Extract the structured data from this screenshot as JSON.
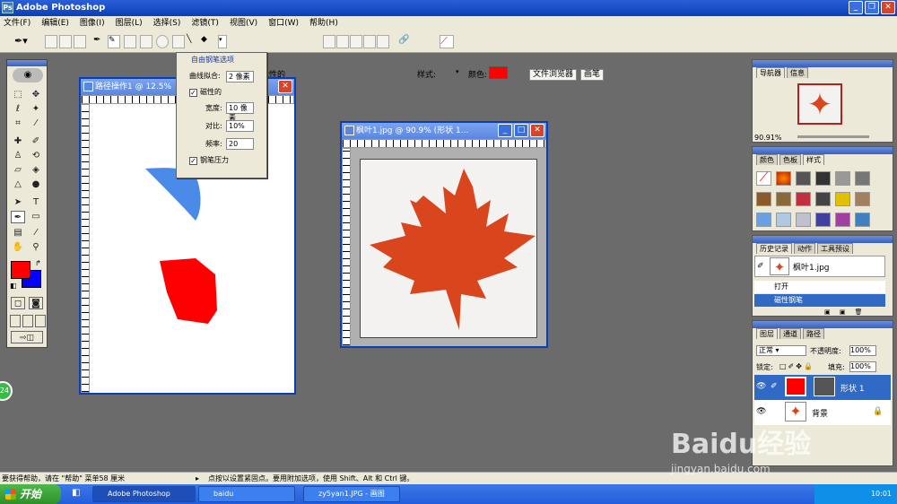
{
  "window": {
    "title": "Adobe Photoshop"
  },
  "menu": [
    "文件(F)",
    "编辑(E)",
    "图像(I)",
    "图层(L)",
    "选择(S)",
    "滤镜(T)",
    "视图(V)",
    "窗口(W)",
    "帮助(H)"
  ],
  "options": {
    "magnetic_label": "磁性的",
    "style_label": "样式:",
    "color_label": "颜色:",
    "color": "#ff0000",
    "tab_browser": "文件浏览器",
    "tab_brush": "画笔"
  },
  "freeform_popup": {
    "title": "自由钢笔选项",
    "curve_fit_label": "曲线拟合:",
    "curve_fit_value": "2 像素",
    "magnetic_label": "磁性的",
    "width_label": "宽度:",
    "width_value": "10 像素",
    "contrast_label": "对比:",
    "contrast_value": "10%",
    "frequency_label": "频率:",
    "frequency_value": "20",
    "pen_pressure_label": "钢笔压力"
  },
  "doc1": {
    "title": "路径操作1 @ 12.5%"
  },
  "doc2": {
    "title": "枫叶1.jpg @ 90.9% (形状 1..."
  },
  "navigator": {
    "tab1": "导航器",
    "tab2": "信息",
    "zoom": "90.91%"
  },
  "swatches": {
    "tab1": "颜色",
    "tab2": "色板",
    "tab3": "样式"
  },
  "history": {
    "tab1": "历史记录",
    "tab2": "动作",
    "tab3": "工具预设",
    "snapshot": "枫叶1.jpg",
    "items": [
      "打开",
      "磁性钢笔"
    ]
  },
  "layers": {
    "tab1": "图层",
    "tab2": "通道",
    "tab3": "路径",
    "blend_mode": "正常",
    "opacity_label": "不透明度:",
    "opacity_value": "100%",
    "lock_label": "锁定:",
    "fill_label": "填充:",
    "fill_value": "100%",
    "rows": [
      "形状 1",
      "背景"
    ]
  },
  "status": {
    "left": "要获得帮助，请在 \"帮助\" 菜单58 厘米",
    "right": "点按以设置紧固点。要用附加选项，使用 Shift、Alt 和 Ctrl 键。"
  },
  "taskbar": {
    "start": "开始",
    "tasks": [
      "Adobe Photoshop",
      "baidu",
      "zy5yan1.JPG - 画图"
    ],
    "clock": "10:01"
  },
  "watermark": {
    "brand": "Baidu经验",
    "url": "jingyan.baidu.com"
  },
  "badge": "24",
  "colors": {
    "leaf": "#d9451d",
    "red": "#ff0000",
    "titlebar": "#0a3fb8"
  }
}
